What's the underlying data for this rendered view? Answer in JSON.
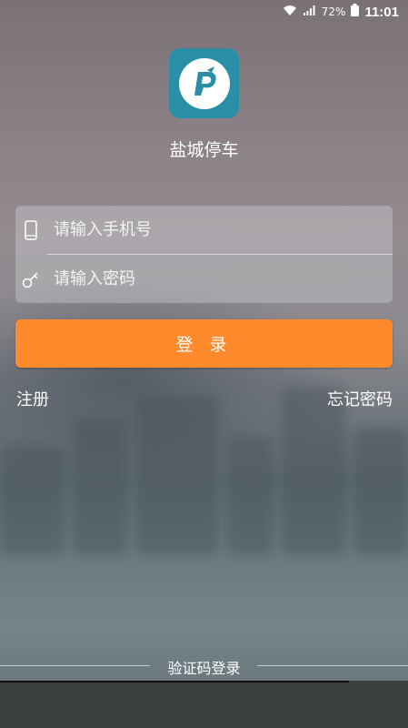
{
  "status_bar": {
    "battery_percent": "72%",
    "time": "11:01",
    "icons": [
      "wifi-icon",
      "signal-icon",
      "battery-icon"
    ]
  },
  "app": {
    "name": "盐城停车",
    "logo_icon": "parking-logo-icon",
    "logo_color": "#2a8fa6"
  },
  "form": {
    "phone_placeholder": "请输入手机号",
    "password_placeholder": "请输入密码",
    "phone_icon": "phone-icon",
    "password_icon": "key-icon"
  },
  "login_button": {
    "label": "登 录",
    "color": "#ff8a2c"
  },
  "links": {
    "register": "注册",
    "forgot_password": "忘记密码",
    "sms_login": "验证码登录"
  }
}
